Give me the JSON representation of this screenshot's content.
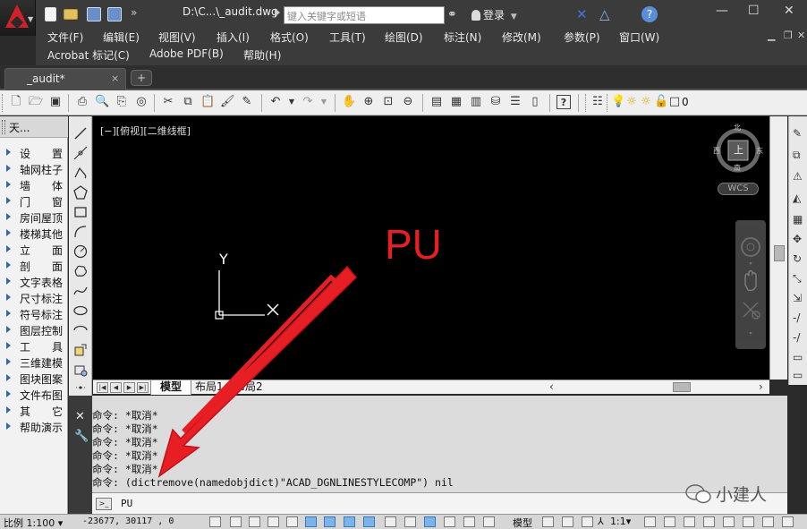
{
  "titlebar": {
    "file_title": "D:\\C...\\_audit.dwg",
    "search_placeholder": "键入关键字或短语",
    "login_label": "登录"
  },
  "menubar": {
    "row1": [
      "文件(F)",
      "编辑(E)",
      "视图(V)",
      "插入(I)",
      "格式(O)",
      "工具(T)",
      "绘图(D)",
      "标注(N)",
      "修改(M)",
      "参数(P)",
      "窗口(W)"
    ],
    "row2": [
      "Acrobat 标记(C)",
      "Adobe PDF(B)",
      "帮助(H)"
    ]
  },
  "doc_tab": {
    "label": "_audit*",
    "close": "×",
    "new_tab": "+"
  },
  "toolbar": {
    "layer_name": "0"
  },
  "tool_panel": {
    "title": "天...",
    "items": [
      "设　置",
      "轴网柱子",
      "墙　体",
      "门　窗",
      "房间屋顶",
      "楼梯其他",
      "立　面",
      "剖　面",
      "文字表格",
      "尺寸标注",
      "符号标注",
      "图层控制",
      "工　具",
      "三维建模",
      "图块图案",
      "文件布图",
      "其　它",
      "帮助演示"
    ]
  },
  "viewport": {
    "label": "[−][俯视][二维线框]",
    "ucs_y": "Y",
    "viewcube": {
      "top": "上",
      "north": "北",
      "south": "南",
      "east": "东",
      "west": "西"
    },
    "wcs": "WCS"
  },
  "layout_tabs": [
    "模型",
    "布局1",
    "布局2"
  ],
  "command_history": [
    "命令: *取消*",
    "命令: *取消*",
    "命令: *取消*",
    "命令: *取消*",
    "命令: *取消*",
    "命令: (dictremove(namedobjdict)\"ACAD_DGNLINESTYLECOMP\") nil"
  ],
  "command_input": {
    "prompt_icon": ">_",
    "value": "PU"
  },
  "annotation": {
    "text": "PU",
    "color": "#e81e25"
  },
  "statusbar": {
    "scale": "比例 1:100 ▾",
    "coords": "-23677, 30117 , 0",
    "model_label": "模型",
    "anno_scale": "1:1▾"
  },
  "watermark": {
    "text": "小建人"
  }
}
